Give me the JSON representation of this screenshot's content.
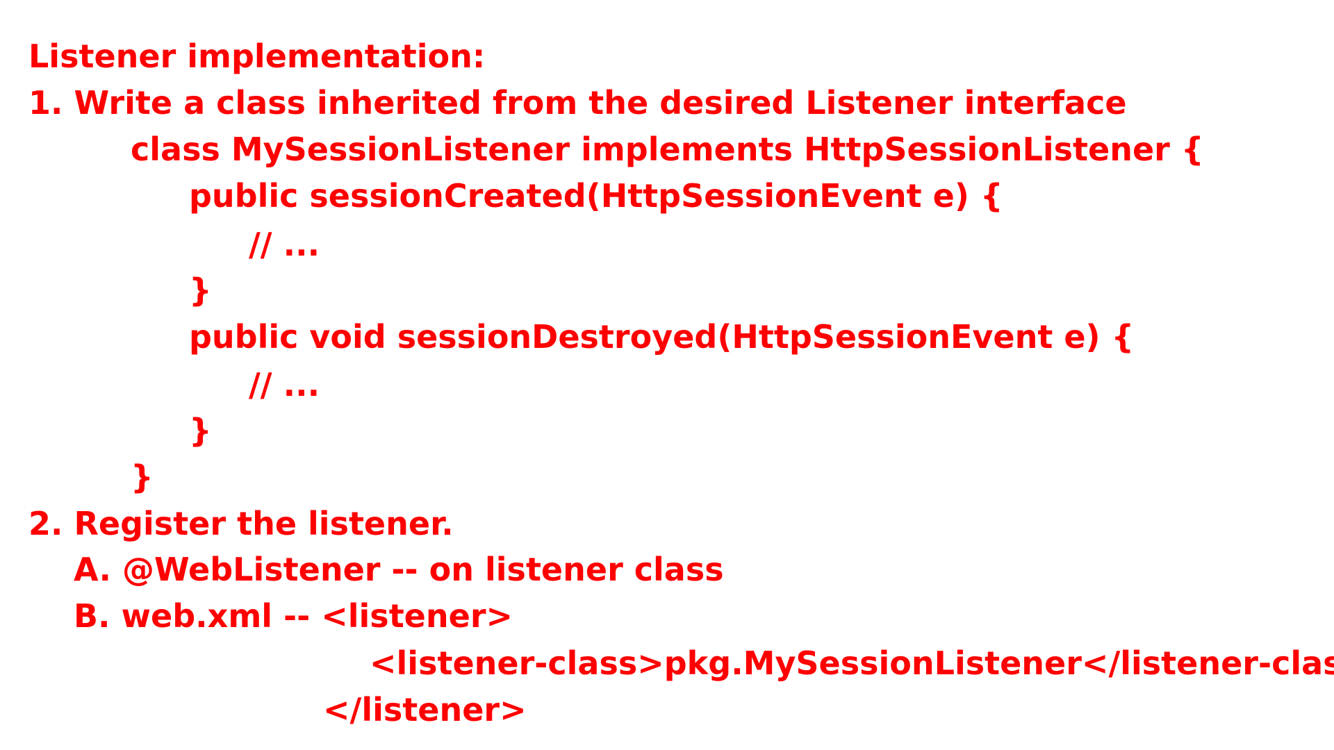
{
  "slide": {
    "heading": "Listener implementation:",
    "step1": {
      "text": "1. Write a class inherited from the desired Listener interface",
      "code": {
        "class_decl": "class MySessionListener implements HttpSessionListener {",
        "method1_sig": "public sessionCreated(HttpSessionEvent e) {",
        "method1_body": "// ...",
        "method1_close": "}",
        "method2_sig": "public void sessionDestroyed(HttpSessionEvent e) {",
        "method2_body": "// ...",
        "method2_close": "}",
        "class_close": "}"
      }
    },
    "step2": {
      "text": "2. Register the listener.",
      "option_a": "A. @WebListener -- on listener class",
      "option_b": "B. web.xml -- <listener>",
      "xml_listener_class": "<listener-class>pkg.MySessionListener</listener-class>",
      "xml_close": "</listener>"
    }
  },
  "colors": {
    "text": "#ff0000",
    "background": "#ffffff"
  }
}
